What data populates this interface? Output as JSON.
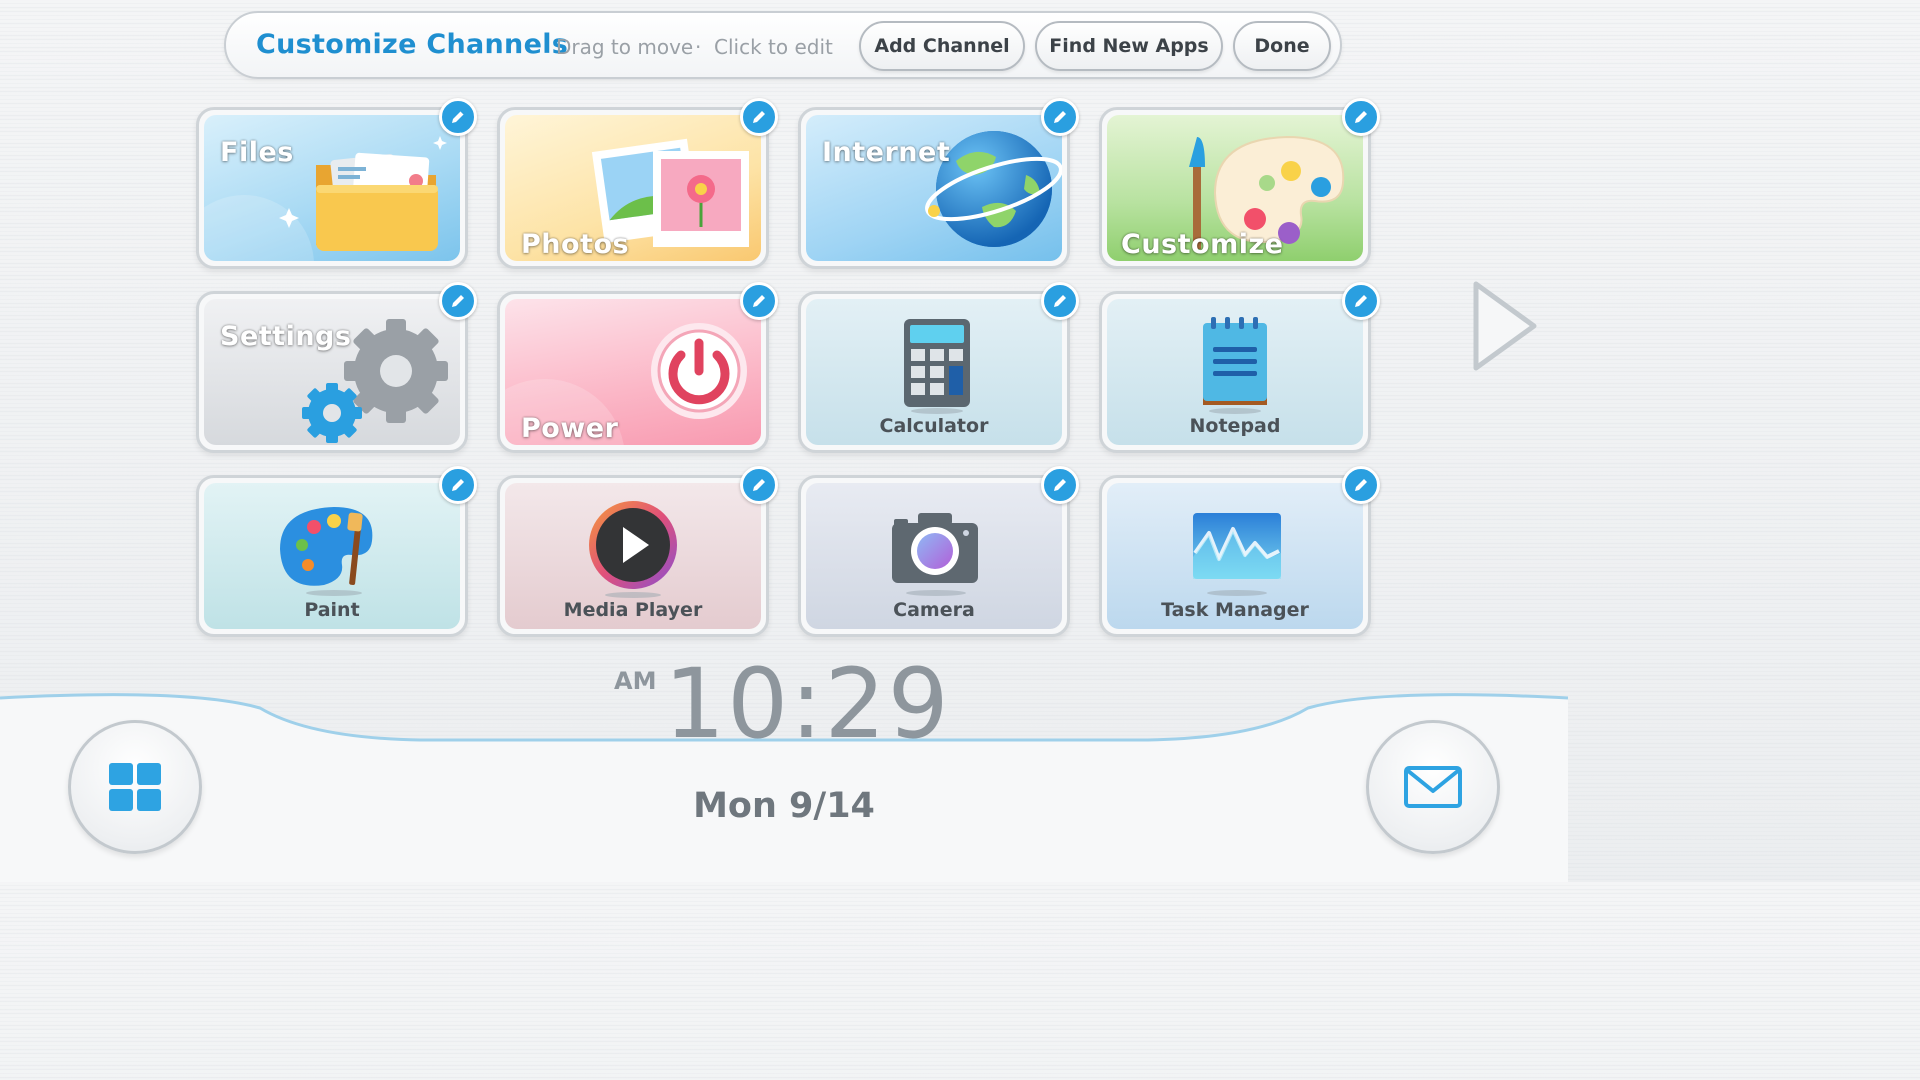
{
  "header": {
    "title": "Customize Channels",
    "hint_drag": "Drag to move",
    "hint_sep": "·",
    "hint_click": "Click to edit",
    "add_channel": "Add Channel",
    "find_new_apps": "Find New Apps",
    "done": "Done"
  },
  "channels": [
    {
      "label": "Files",
      "icon": "folder-icon"
    },
    {
      "label": "Photos",
      "icon": "photos-icon"
    },
    {
      "label": "Internet",
      "icon": "globe-icon"
    },
    {
      "label": "Customize",
      "icon": "palette-icon"
    },
    {
      "label": "Settings",
      "icon": "gear-icon"
    },
    {
      "label": "Power",
      "icon": "power-icon"
    },
    {
      "label": "Calculator",
      "icon": "calculator-icon"
    },
    {
      "label": "Notepad",
      "icon": "notepad-icon"
    },
    {
      "label": "Paint",
      "icon": "paint-palette-icon"
    },
    {
      "label": "Media Player",
      "icon": "play-icon"
    },
    {
      "label": "Camera",
      "icon": "camera-icon"
    },
    {
      "label": "Task Manager",
      "icon": "activity-graph-icon"
    }
  ],
  "clock": {
    "ampm": "AM",
    "time": "10:29"
  },
  "date": "Mon 9/14",
  "colors": {
    "accent": "#2a9fe0",
    "title": "#1f8fd0",
    "clock": "#8e969d"
  }
}
